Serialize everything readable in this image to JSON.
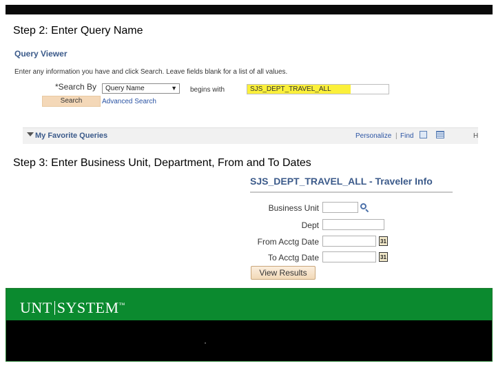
{
  "slide": {
    "step2_title": "Step 2: Enter Query Name",
    "step3_title": "Step 3: Enter Business Unit, Department, From and To Dates"
  },
  "query_viewer": {
    "title": "Query Viewer",
    "instructions": "Enter any information you have and click Search. Leave fields blank for a list of all values.",
    "search_by_label": "*Search By",
    "search_by_value": "Query Name",
    "operator": "begins with",
    "query_value": "SJS_DEPT_TRAVEL_ALL",
    "search_button": "Search",
    "advanced_search": "Advanced Search",
    "favorites_label": "My Favorite Queries",
    "personalize": "Personalize",
    "separator": "|",
    "find": "Find",
    "last_char": "H"
  },
  "traveler_form": {
    "title": "SJS_DEPT_TRAVEL_ALL - Traveler Info",
    "fields": [
      {
        "label": "Business Unit",
        "value": ""
      },
      {
        "label": "Dept",
        "value": ""
      },
      {
        "label": "From Acctg Date",
        "value": ""
      },
      {
        "label": "To Acctg Date",
        "value": ""
      }
    ],
    "calendar_glyph": "31",
    "view_results_button": "View Results"
  },
  "footer": {
    "logo_left": "UNT",
    "logo_right": "SYSTEM",
    "logo_mark": "™"
  },
  "colors": {
    "title_blue": "#3b5a8a",
    "link_blue": "#2a53a3",
    "highlight_yellow": "#fbf03a",
    "search_button_bg": "#f4d8b8",
    "footer_green": "#0b8a2f"
  }
}
